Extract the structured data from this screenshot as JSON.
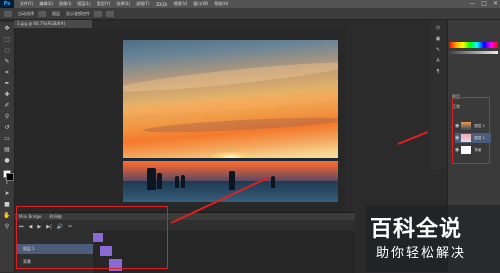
{
  "menubar": {
    "logo": "Ps",
    "items": [
      "文件(F)",
      "编辑(E)",
      "图像(I)",
      "图层(L)",
      "类型(Y)",
      "选择(S)",
      "滤镜(T)",
      "3D(D)",
      "视图(V)",
      "窗口(W)",
      "帮助(H)"
    ],
    "window_buttons": [
      "—",
      "□",
      "✕"
    ]
  },
  "optionsbar": {
    "items": [
      "自动选择",
      "图层",
      "显示变换控件"
    ]
  },
  "document_tab": {
    "label": "3.jpg @ 66.7%(RGB/8#)"
  },
  "timeline": {
    "tabs": [
      "Mini Bridge",
      "时间轴"
    ],
    "controls": [
      "⏮",
      "◀",
      "▶",
      "▶|",
      "🔊",
      "✂"
    ],
    "rows": [
      "图层 1",
      "背景"
    ]
  },
  "layers_panel": {
    "labels": [
      "图层",
      "正常"
    ],
    "layers": [
      "图层 2",
      "图层 1",
      "背景"
    ]
  },
  "watermark": {
    "title": "百科全说",
    "subtitle": "助你轻松解决"
  },
  "colors": {
    "annotation_red": "#e02020",
    "clip_purple": "#8a6bd6"
  }
}
